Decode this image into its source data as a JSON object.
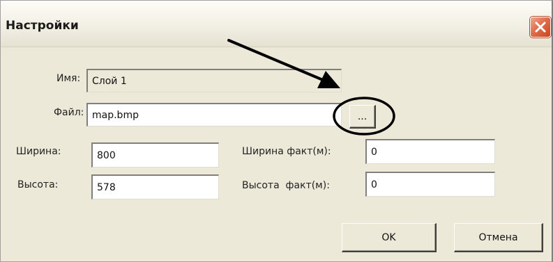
{
  "window": {
    "title": "Настройки"
  },
  "form": {
    "name_label": "Имя:",
    "name_value": "Слой 1",
    "file_label": "Файл:",
    "file_value": "map.bmp",
    "browse_label": "...",
    "width_label": "Ширина:",
    "width_value": "800",
    "height_label": "Высота:",
    "height_value": "578",
    "width_actual_label": "Ширина факт(м):",
    "width_actual_value": "0",
    "height_actual_label": "Высота  факт(м):",
    "height_actual_value": "0"
  },
  "buttons": {
    "ok_label": "OK",
    "cancel_label": "Отмена"
  },
  "icons": {
    "close": "close-icon"
  },
  "colors": {
    "dialog_bg": "#ece9d8",
    "close_button": "#e06e4b",
    "annotation": "#000000"
  }
}
